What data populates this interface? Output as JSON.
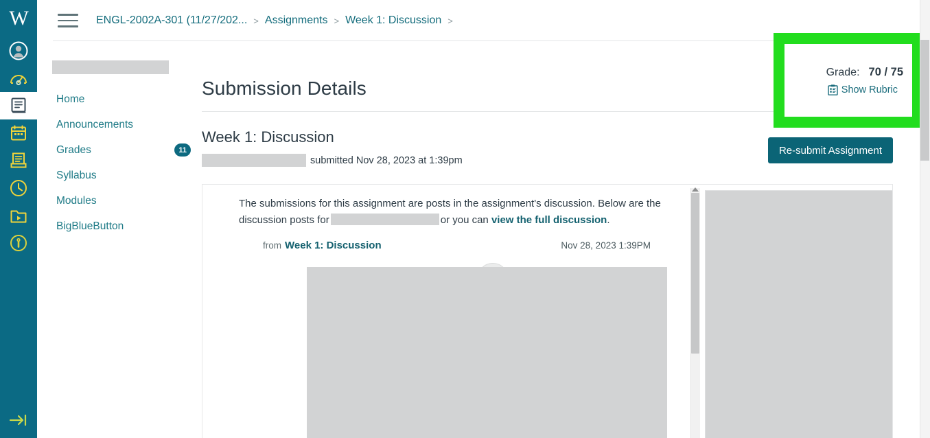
{
  "global_nav": {
    "logo_text": "W",
    "items": [
      {
        "name": "account",
        "icon": "user-circle-icon",
        "active": false
      },
      {
        "name": "dashboard",
        "icon": "gauge-icon",
        "active": false
      },
      {
        "name": "courses",
        "icon": "book-icon",
        "active": true
      },
      {
        "name": "calendar",
        "icon": "calendar-icon",
        "active": false
      },
      {
        "name": "inbox",
        "icon": "inbox-icon",
        "active": false
      },
      {
        "name": "history",
        "icon": "clock-icon",
        "active": false
      },
      {
        "name": "studio",
        "icon": "folder-play-icon",
        "active": false
      },
      {
        "name": "help",
        "icon": "info-circle-icon",
        "active": false
      }
    ],
    "bottom_item": {
      "name": "minimize-nav",
      "icon": "arrow-to-line-icon"
    }
  },
  "topbar": {
    "menu_icon": "hamburger-icon",
    "breadcrumb": [
      {
        "label": "ENGL-2002A-301 (11/27/202...",
        "sep": ">"
      },
      {
        "label": "Assignments",
        "sep": ">"
      },
      {
        "label": "Week 1: Discussion",
        "sep": ">"
      }
    ]
  },
  "course_nav": {
    "course_name_redacted": true,
    "items": [
      {
        "label": "Home",
        "badge": null
      },
      {
        "label": "Announcements",
        "badge": null
      },
      {
        "label": "Grades",
        "badge": "11"
      },
      {
        "label": "Syllabus",
        "badge": null
      },
      {
        "label": "Modules",
        "badge": null
      },
      {
        "label": "BigBlueButton",
        "badge": null
      }
    ]
  },
  "main": {
    "page_title": "Submission Details",
    "assignment_title": "Week 1: Discussion",
    "submitted_text": "submitted Nov 28, 2023 at 1:39pm",
    "resubmit_label": "Re-submit Assignment"
  },
  "grade_box": {
    "highlight_color": "#22dd1e",
    "label": "Grade:",
    "value": "70 / 75",
    "rubric_label": "Show Rubric",
    "rubric_icon": "rubric-clipboard-icon"
  },
  "submission": {
    "intro_part1": "The submissions for this assignment are posts in the assignment's discussion. Below are the discussion posts for",
    "intro_part2": "or you can",
    "intro_link": "view the full discussion",
    "intro_period": ".",
    "post_from_label": "from",
    "post_topic": "Week 1: Discussion",
    "post_date": "Nov 28, 2023 1:39PM",
    "avatar_icon": "user-avatar-icon"
  },
  "colors": {
    "nav_teal": "#0b6a84",
    "link_teal": "#1f7b87",
    "button_teal": "#0b6476",
    "highlight_green": "#22dd1e",
    "redaction_grey": "#d2d3d4"
  }
}
